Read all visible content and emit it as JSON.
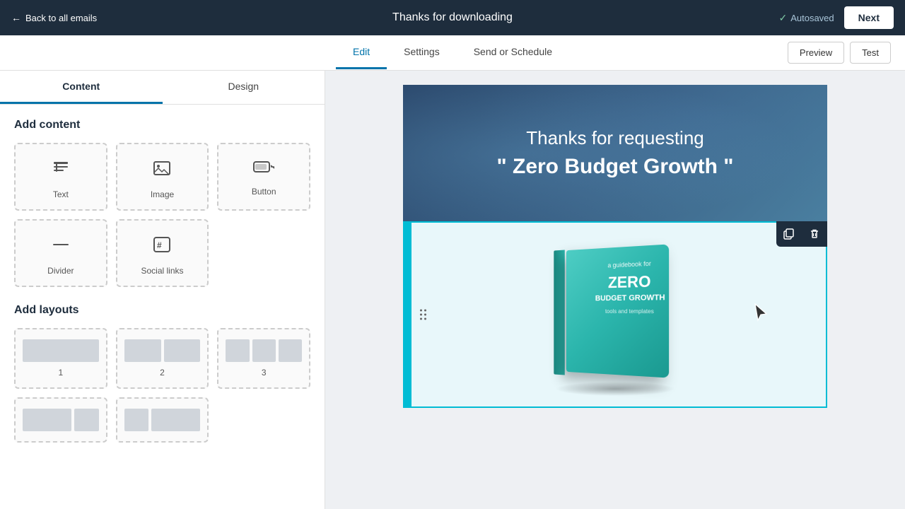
{
  "topbar": {
    "back_label": "Back to all emails",
    "title": "Thanks for downloading",
    "autosaved_label": "Autosaved",
    "next_label": "Next"
  },
  "secondarynav": {
    "tabs": [
      {
        "id": "edit",
        "label": "Edit",
        "active": true
      },
      {
        "id": "settings",
        "label": "Settings",
        "active": false
      },
      {
        "id": "send",
        "label": "Send or Schedule",
        "active": false
      }
    ],
    "preview_label": "Preview",
    "test_label": "Test"
  },
  "sidebar": {
    "tab_content": "Content",
    "tab_design": "Design",
    "add_content_title": "Add content",
    "items": [
      {
        "id": "text",
        "label": "Text",
        "icon": "≡"
      },
      {
        "id": "image",
        "label": "Image",
        "icon": "⛰"
      },
      {
        "id": "button",
        "label": "Button",
        "icon": "▬"
      }
    ],
    "items2": [
      {
        "id": "divider",
        "label": "Divider",
        "icon": "—"
      },
      {
        "id": "social",
        "label": "Social links",
        "icon": "#"
      }
    ],
    "add_layouts_title": "Add layouts",
    "layouts": [
      {
        "id": "1",
        "label": "1",
        "cols": 1
      },
      {
        "id": "2",
        "label": "2",
        "cols": 2
      },
      {
        "id": "3",
        "label": "3",
        "cols": 3
      }
    ]
  },
  "canvas": {
    "email_header": {
      "line1": "Thanks for requesting",
      "line2": "\" Zero Budget Growth \""
    },
    "book": {
      "subtitle": "a guidebook for",
      "title_main": "ZERO",
      "title_sub": "BUDGET GROWTH",
      "bottom": "tools and templates"
    },
    "block_actions": {
      "copy_title": "Copy block",
      "delete_title": "Delete block"
    }
  }
}
